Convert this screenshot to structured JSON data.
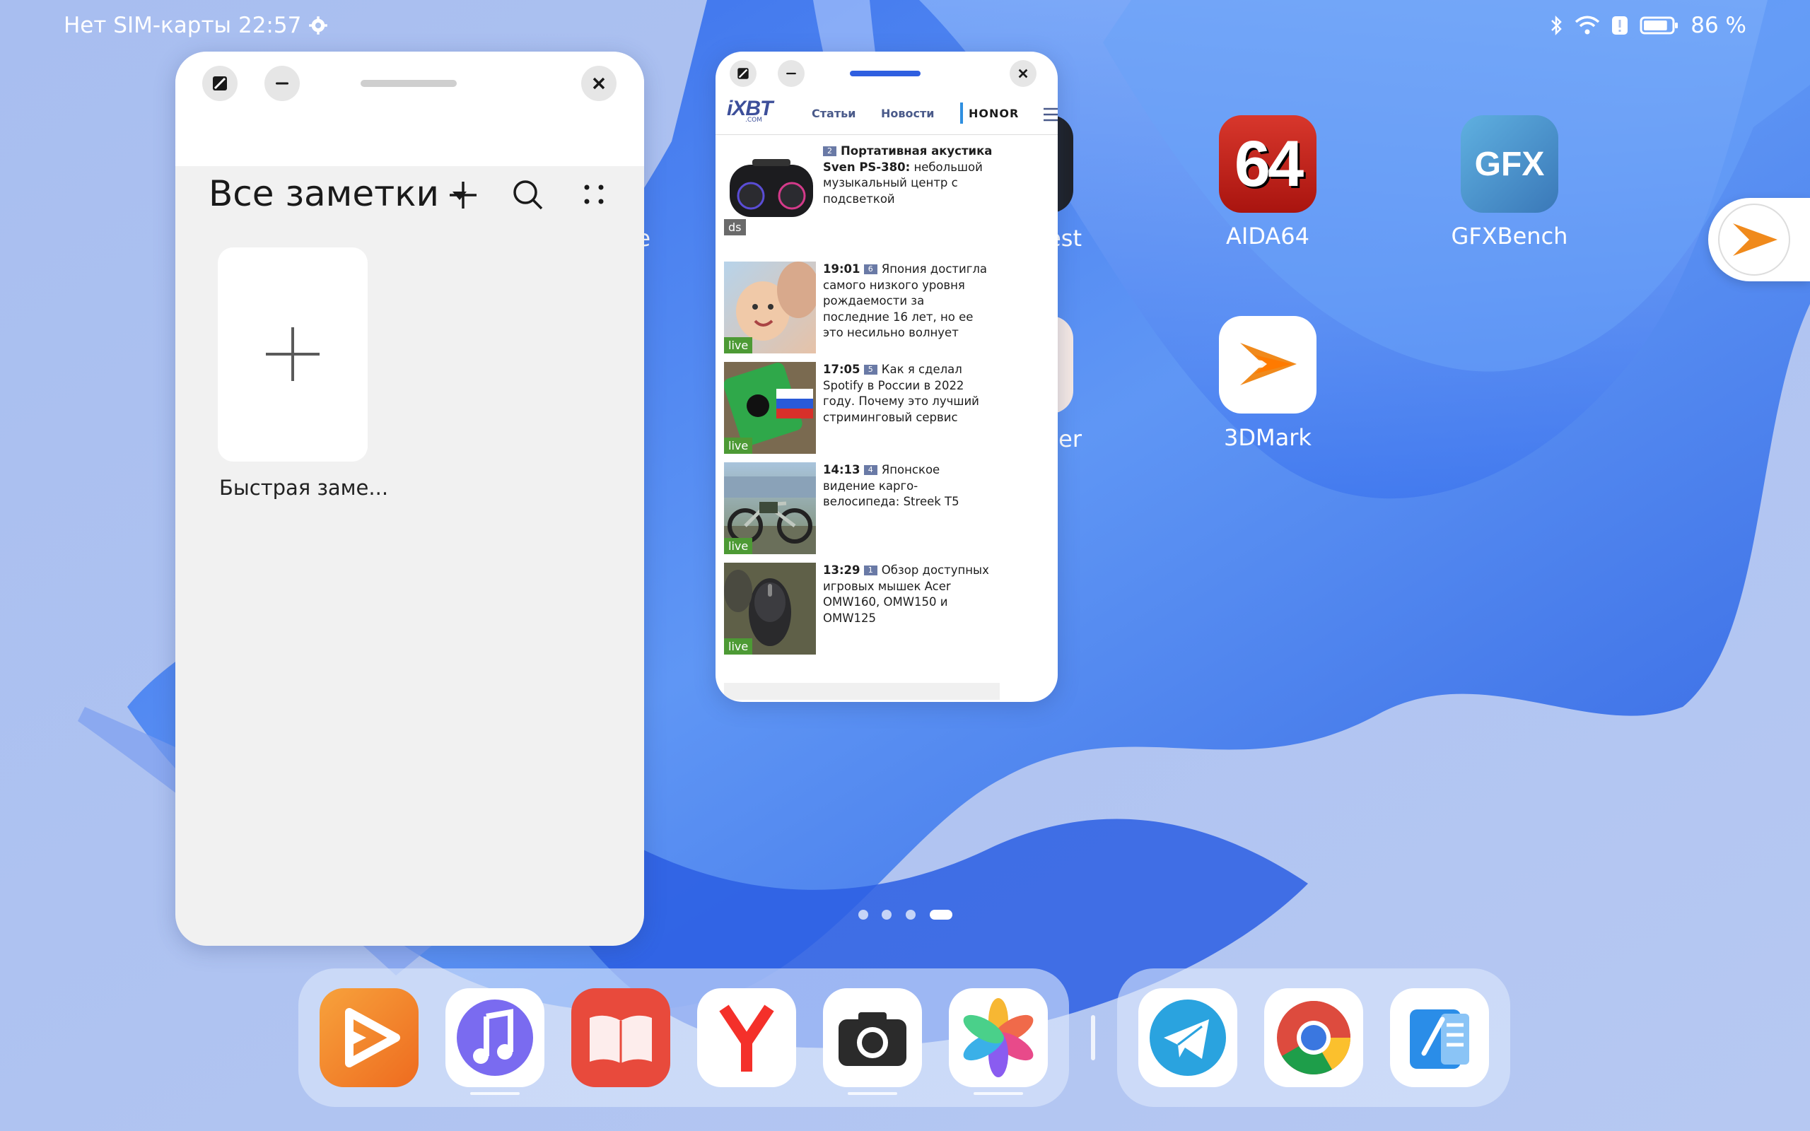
{
  "status_bar": {
    "carrier": "Нет SIM-карты",
    "time": "22:57",
    "battery_percent": "86 %",
    "battery_level": 0.86,
    "icons": [
      "gear-icon",
      "bluetooth-icon",
      "wifi-icon",
      "alert-icon",
      "battery-icon"
    ]
  },
  "home_apps": [
    {
      "label": "AIDA64",
      "icon_text": "64",
      "icon_color": "#c5231d"
    },
    {
      "label": "GFXBench",
      "icon_text": "GFX",
      "icon_color": "#4a8ec6"
    },
    {
      "label": "3DMark",
      "icon_color": "#ffffff"
    }
  ],
  "partially_hidden_labels": [
    "e",
    "est",
    "er"
  ],
  "notes_window": {
    "title": "Все заметки",
    "note_label": "Быстрая заме..."
  },
  "browser_window": {
    "logo": "iXBT",
    "logo_sub": ".COM",
    "nav": [
      "Статьи",
      "Новости",
      "HONOR"
    ],
    "news": [
      {
        "time": "",
        "count": "2",
        "title_bold": "Портативная акустика Sven PS-380:",
        "title": "небольшой музыкальный центр с подсветкой",
        "badge": "ds"
      },
      {
        "time": "19:01",
        "count": "6",
        "title_bold": "",
        "title": "Япония достигла самого низкого уровня рождаемости за последние 16 лет, но ее это несильно волнует",
        "badge": "live"
      },
      {
        "time": "17:05",
        "count": "5",
        "title_bold": "",
        "title": "Как я сделал Spotify в России в 2022 году. Почему это лучший стриминговый сервис",
        "badge": "live"
      },
      {
        "time": "14:13",
        "count": "4",
        "title_bold": "",
        "title": "Японское видение карго-велосипеда: Streek T5",
        "badge": "live"
      },
      {
        "time": "13:29",
        "count": "1",
        "title_bold": "",
        "title": "Обзор доступных игровых мышек Acer OMW160, OMW150 и OMW125",
        "badge": "live"
      }
    ]
  },
  "page_indicator": {
    "pages": 4,
    "current": 4
  },
  "dock": {
    "apps": [
      "video-app",
      "music-app",
      "books-app",
      "yandex-app",
      "camera-app",
      "gallery-app"
    ],
    "recent": [
      "telegram-app",
      "chrome-app",
      "notes-app"
    ]
  },
  "colors": {
    "accent": "#2f5fe0",
    "wallpaper_blue": "#3d7bf0"
  }
}
